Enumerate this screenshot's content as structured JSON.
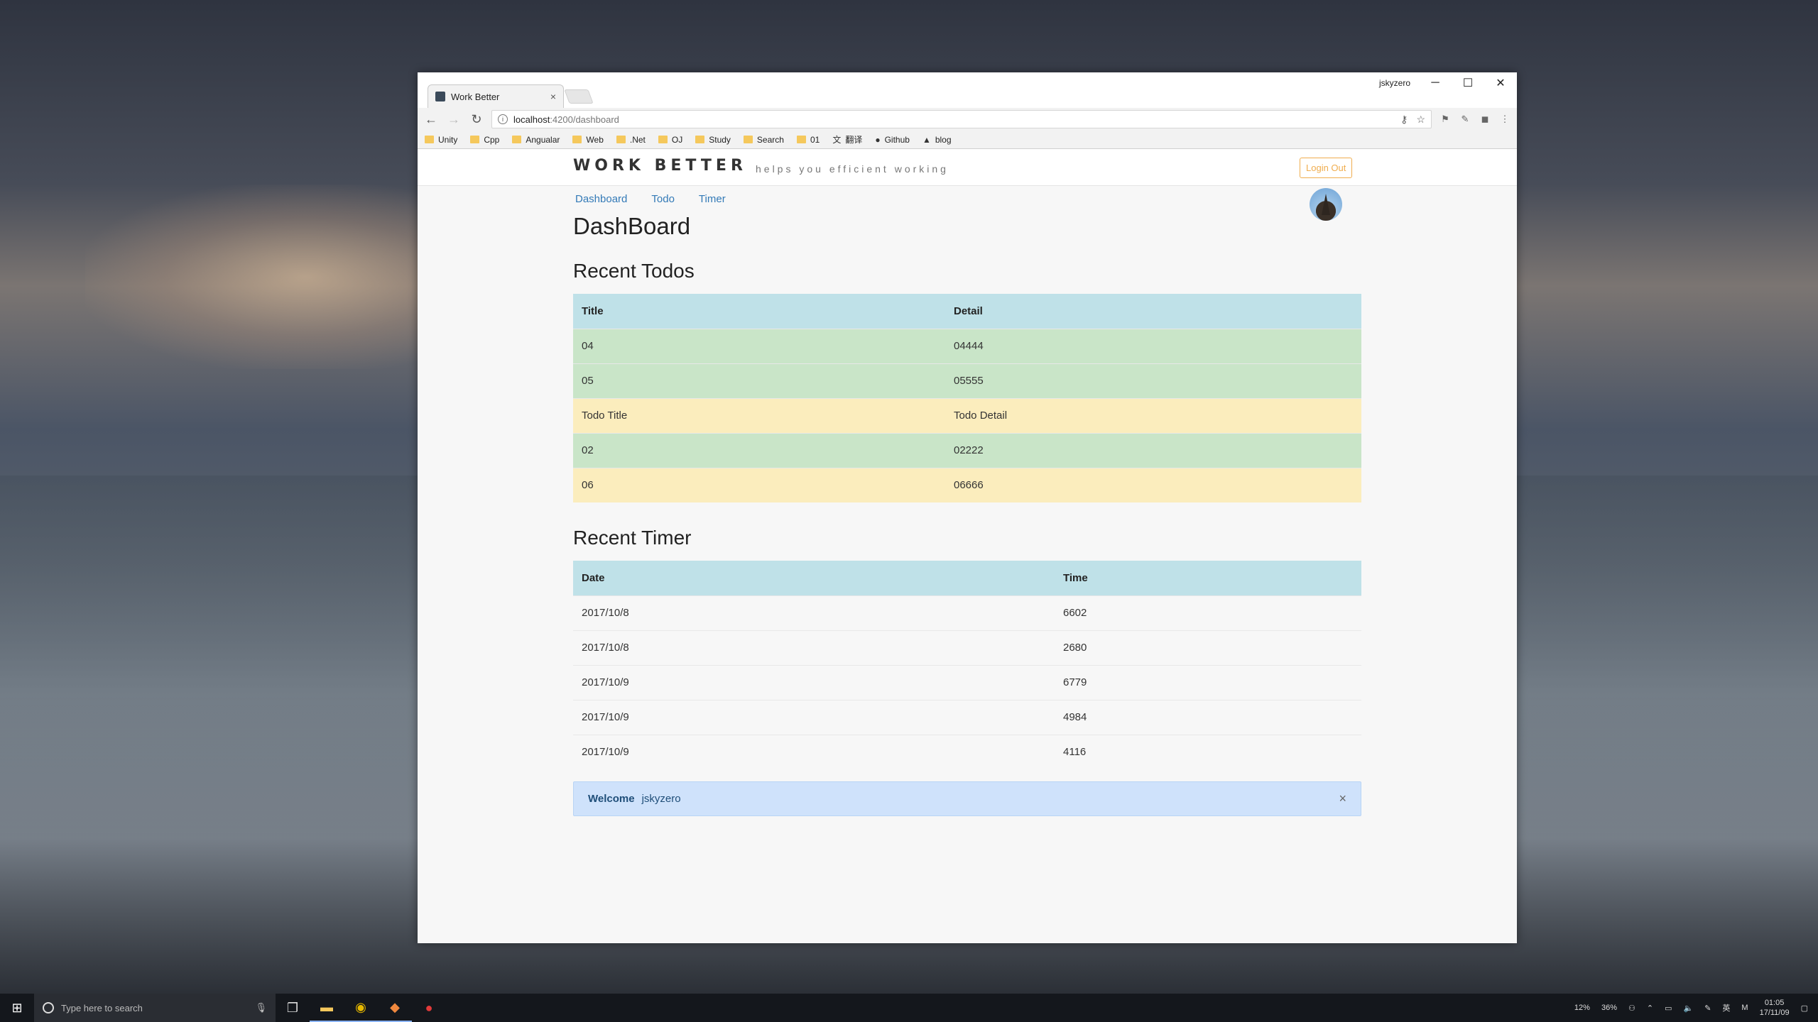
{
  "window": {
    "tab_title": "Work Better",
    "tab_close": "×",
    "user": "jskyzero",
    "controls": [
      "─",
      "☐",
      "✕"
    ]
  },
  "toolbar": {
    "back": "←",
    "forward": "→",
    "reload": "↻",
    "url_host": "localhost",
    "url_path": ":4200/dashboard",
    "info": "i",
    "key": "⚷",
    "star": "☆",
    "menu": "⋮"
  },
  "bookmarks": [
    {
      "label": "Unity",
      "kind": "folder"
    },
    {
      "label": "Cpp",
      "kind": "folder"
    },
    {
      "label": "Angualar",
      "kind": "folder"
    },
    {
      "label": "Web",
      "kind": "folder"
    },
    {
      "label": ".Net",
      "kind": "folder"
    },
    {
      "label": "OJ",
      "kind": "folder"
    },
    {
      "label": "Study",
      "kind": "folder"
    },
    {
      "label": "Search",
      "kind": "folder"
    },
    {
      "label": "01",
      "kind": "folder"
    },
    {
      "label": "翻译",
      "kind": "translate-icon"
    },
    {
      "label": "Github",
      "kind": "github-icon"
    },
    {
      "label": "blog",
      "kind": "blog-icon"
    }
  ],
  "header": {
    "brand": "WORK BETTER",
    "tagline": "helps you efficient working",
    "logout": "Login Out"
  },
  "nav": {
    "dashboard": "Dashboard",
    "todo": "Todo",
    "timer": "Timer"
  },
  "page": {
    "title": "DashBoard"
  },
  "todos": {
    "section_title": "Recent Todos",
    "headers": [
      "Title",
      "Detail"
    ],
    "rows": [
      {
        "title": "04",
        "detail": "04444",
        "status": "success"
      },
      {
        "title": "05",
        "detail": "05555",
        "status": "success"
      },
      {
        "title": "Todo Title",
        "detail": "Todo Detail",
        "status": "warning"
      },
      {
        "title": "02",
        "detail": "02222",
        "status": "success"
      },
      {
        "title": "06",
        "detail": "06666",
        "status": "warning"
      }
    ]
  },
  "timer": {
    "section_title": "Recent Timer",
    "headers": [
      "Date",
      "Time"
    ],
    "rows": [
      {
        "date": "2017/10/8",
        "time": "6602"
      },
      {
        "date": "2017/10/8",
        "time": "2680"
      },
      {
        "date": "2017/10/9",
        "time": "6779"
      },
      {
        "date": "2017/10/9",
        "time": "4984"
      },
      {
        "date": "2017/10/9",
        "time": "4116"
      }
    ]
  },
  "alert": {
    "label": "Welcome",
    "name": "jskyzero",
    "close": "×"
  },
  "taskbar": {
    "search_placeholder": "Type here to search",
    "cpu": "12%",
    "mem": "36%",
    "time": "01:05",
    "date": "17/11/09"
  },
  "colors": {
    "success_row": "#c9e5c8",
    "warning_row": "#fbedbd",
    "header_row": "#bfe1e8",
    "alert_bg": "#cfe2fb",
    "link": "#337ab7",
    "logout": "#f0ad4e"
  }
}
